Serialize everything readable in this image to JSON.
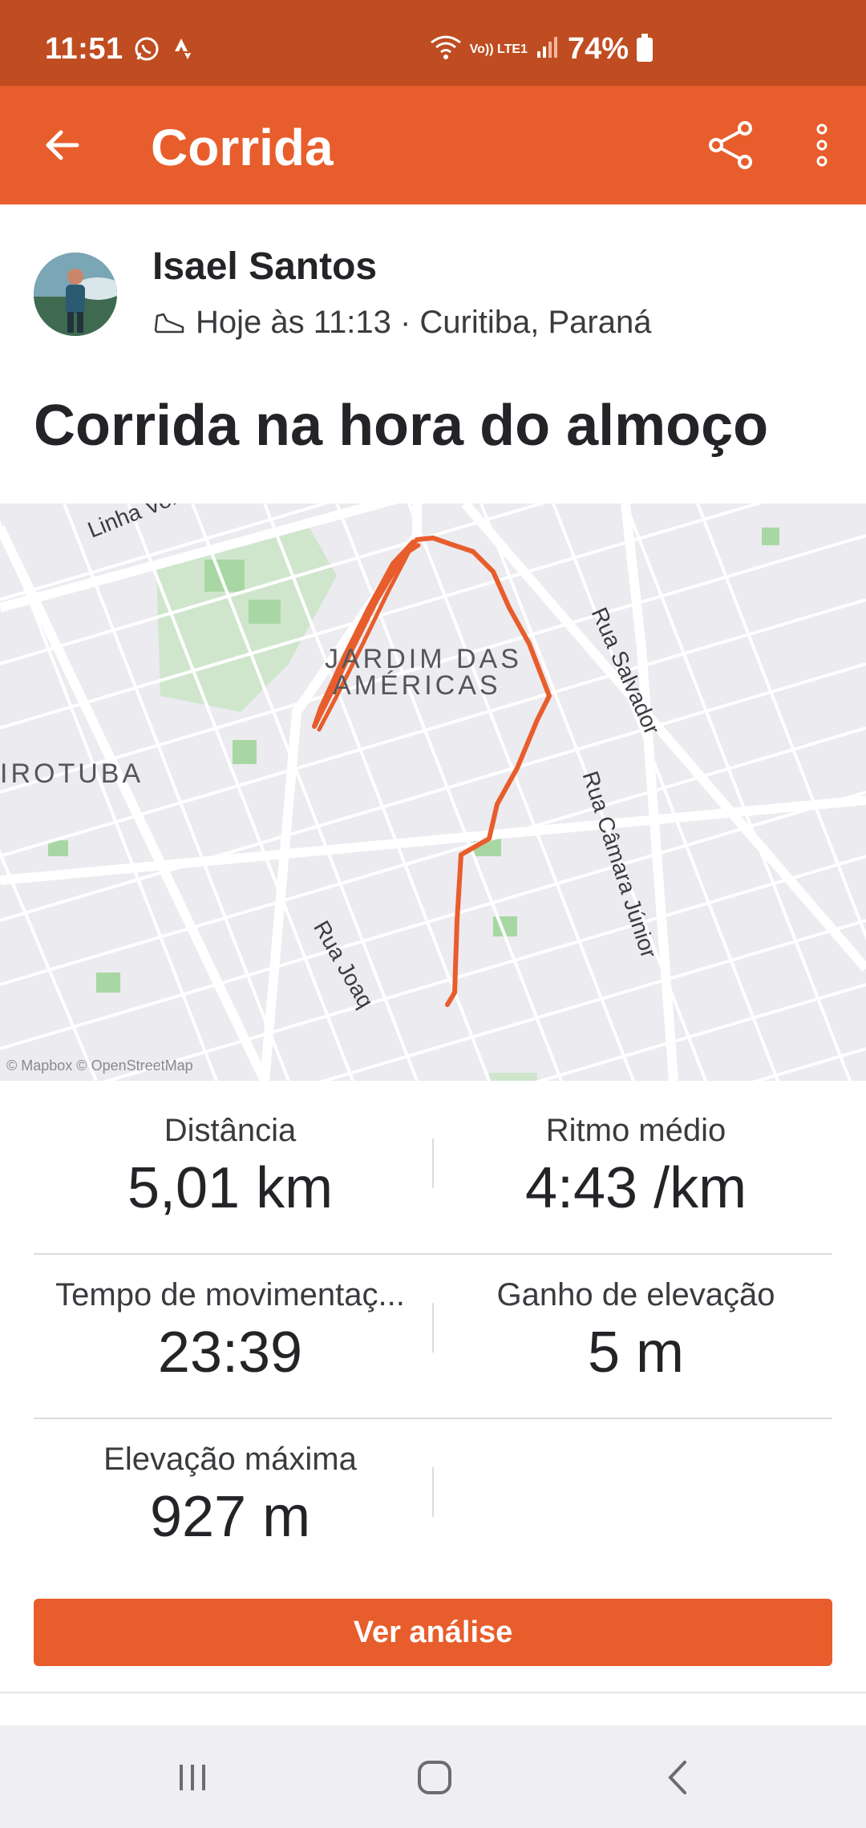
{
  "status_bar": {
    "time": "11:51",
    "battery": "74%",
    "network": "Vo)) LTE1"
  },
  "app_bar": {
    "title": "Corrida"
  },
  "athlete": {
    "name": "Isael Santos",
    "meta": "Hoje às 11:13 · Curitiba, Paraná"
  },
  "activity": {
    "title": "Corrida na hora do almoço"
  },
  "map": {
    "neighborhood_line1": "JARDIM DAS",
    "neighborhood_line2": "AMÉRICAS",
    "district": "IROTUBA",
    "streets": [
      "Linha Verde",
      "Rua Salvador",
      "Rua Câmara Júnior",
      "Rua Joaq"
    ],
    "attribution": "© Mapbox © OpenStreetMap",
    "route_color": "#e85d2c"
  },
  "stats": [
    {
      "left_label": "Distância",
      "left_value": "5,01 km",
      "right_label": "Ritmo médio",
      "right_value": "4:43 /km"
    },
    {
      "left_label": "Tempo de movimentaç...",
      "left_value": "23:39",
      "right_label": "Ganho de elevação",
      "right_value": "5 m"
    },
    {
      "left_label": "Elevação máxima",
      "left_value": "927 m",
      "right_label": "",
      "right_value": ""
    }
  ],
  "actions": {
    "analysis_label": "Ver análise"
  },
  "colors": {
    "accent": "#e85d2c",
    "status_bar": "#bf4d21"
  }
}
